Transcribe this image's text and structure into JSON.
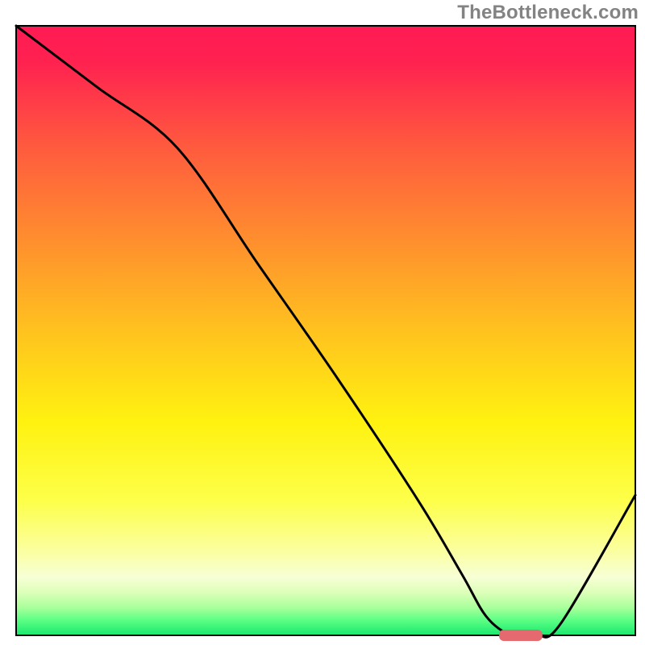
{
  "watermark": "TheBottleneck.com",
  "chart_data": {
    "type": "line",
    "title": "",
    "xlabel": "",
    "ylabel": "",
    "xlim": [
      0,
      100
    ],
    "ylim": [
      0,
      100
    ],
    "grid": false,
    "series": [
      {
        "name": "curve",
        "x": [
          0,
          13,
          26,
          39,
          52,
          65,
          72,
          76,
          80,
          84,
          88,
          100
        ],
        "values": [
          100,
          90,
          80,
          61,
          42,
          22,
          10,
          3,
          0,
          0,
          2,
          23
        ]
      }
    ],
    "marker": {
      "name": "optimal-range",
      "x_start": 78,
      "x_end": 85,
      "y": 0
    },
    "background_gradient": {
      "stops": [
        {
          "offset": 0.0,
          "color": "#ff1a54"
        },
        {
          "offset": 0.06,
          "color": "#ff2250"
        },
        {
          "offset": 0.2,
          "color": "#ff5b3e"
        },
        {
          "offset": 0.35,
          "color": "#ff8e2e"
        },
        {
          "offset": 0.5,
          "color": "#ffc21f"
        },
        {
          "offset": 0.65,
          "color": "#fff210"
        },
        {
          "offset": 0.78,
          "color": "#fdff4a"
        },
        {
          "offset": 0.86,
          "color": "#fbff9e"
        },
        {
          "offset": 0.905,
          "color": "#f7ffd6"
        },
        {
          "offset": 0.93,
          "color": "#dcffb8"
        },
        {
          "offset": 0.955,
          "color": "#a8ff9b"
        },
        {
          "offset": 0.975,
          "color": "#5cff84"
        },
        {
          "offset": 1.0,
          "color": "#18e86f"
        }
      ]
    }
  }
}
